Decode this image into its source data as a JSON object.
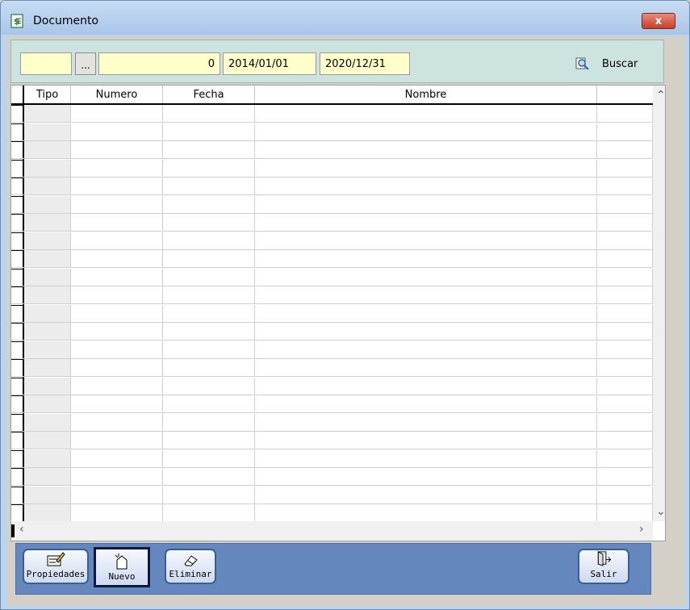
{
  "window": {
    "title": "Documento",
    "close_label": "x"
  },
  "filters": {
    "code_value": "",
    "browse_label": "...",
    "number_value": "0",
    "date_from": "2014/01/01",
    "date_to": "2020/12/31",
    "search_label": "Buscar"
  },
  "grid": {
    "columns": [
      {
        "key": "tipo",
        "label": "Tipo"
      },
      {
        "key": "numero",
        "label": "Numero"
      },
      {
        "key": "fecha",
        "label": "Fecha"
      },
      {
        "key": "nombre",
        "label": "Nombre"
      },
      {
        "key": "extra",
        "label": ""
      }
    ],
    "rows": []
  },
  "scroll": {
    "up": "^",
    "down": "v",
    "left": "<",
    "right": ">"
  },
  "buttons": {
    "properties": "Propiedades",
    "new": "Nuevo",
    "delete": "Eliminar",
    "exit": "Salir"
  },
  "colors": {
    "field_bg": "#ffffcc",
    "toolbar_bg": "#cde3e0",
    "button_bar": "#6488be"
  }
}
